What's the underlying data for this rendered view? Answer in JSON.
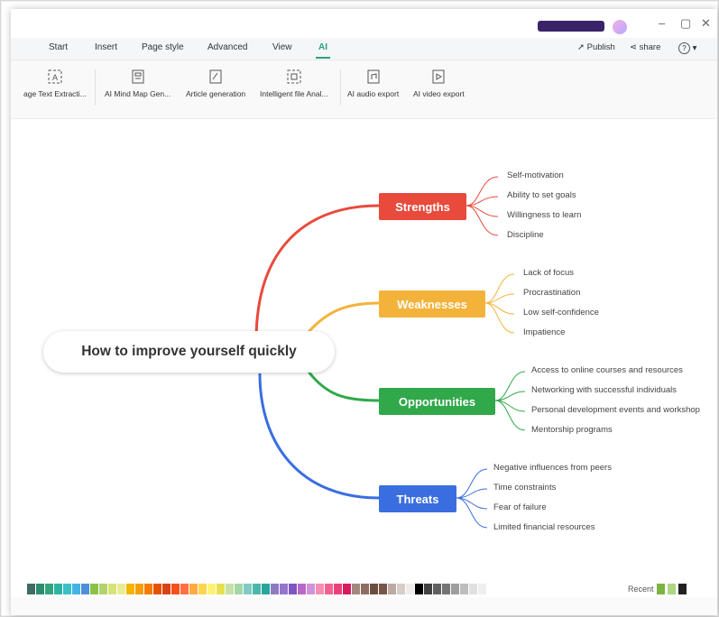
{
  "tabs": [
    {
      "label": "Start"
    },
    {
      "label": "Insert"
    },
    {
      "label": "Page style"
    },
    {
      "label": "Advanced"
    },
    {
      "label": "View"
    },
    {
      "label": "AI"
    }
  ],
  "active_tab": "AI",
  "header_actions": {
    "publish": "Publish",
    "share": "share",
    "help": "?"
  },
  "ribbon": [
    {
      "label": "age Text Extracti...",
      "icon": "text-extract-icon"
    },
    {
      "label": "AI Mind Map Gen...",
      "icon": "mindmap-gen-icon"
    },
    {
      "label": "Article generation",
      "icon": "article-icon"
    },
    {
      "label": "Intelligent file Anal...",
      "icon": "file-analysis-icon"
    },
    {
      "label": "AI audio export",
      "icon": "audio-export-icon"
    },
    {
      "label": "AI video export",
      "icon": "video-export-icon"
    }
  ],
  "mindmap": {
    "central": "How to improve yourself quickly",
    "branches": [
      {
        "title": "Strengths",
        "color": "#e84a3c",
        "items": [
          "Self-motivation",
          "Ability to set goals",
          "Willingness to learn",
          "Discipline"
        ]
      },
      {
        "title": "Weaknesses",
        "color": "#f3b33b",
        "items": [
          "Lack of focus",
          "Procrastination",
          "Low self-confidence",
          "Impatience"
        ]
      },
      {
        "title": "Opportunities",
        "color": "#31a84a",
        "items": [
          "Access to online courses and resources",
          "Networking with successful individuals",
          "Personal development events and workshop",
          "Mentorship programs"
        ]
      },
      {
        "title": "Threats",
        "color": "#3a6ee0",
        "items": [
          "Negative influences from peers",
          "Time constraints",
          "Fear of failure",
          "Limited financial resources"
        ]
      }
    ]
  },
  "palette": {
    "recent_label": "Recent",
    "colors": [
      "#3f6b64",
      "#2d8c6e",
      "#35a37e",
      "#2bb4a3",
      "#3ac1c6",
      "#46b3e6",
      "#4f8fd7",
      "#8bc34a",
      "#b3d36b",
      "#d6e37a",
      "#e8ec94",
      "#f4b400",
      "#f59e0b",
      "#f57c00",
      "#e65100",
      "#d84315",
      "#f4511e",
      "#ff7043",
      "#ffab40",
      "#ffd54f",
      "#fff176",
      "#e6e04d",
      "#c5e1a5",
      "#a5d6a7",
      "#80cbc4",
      "#4db6ac",
      "#26a69a",
      "#8e7cc3",
      "#9575cd",
      "#7e57c2",
      "#ba68c8",
      "#ce93d8",
      "#f48fb1",
      "#f06292",
      "#ec407a",
      "#d81b60",
      "#a1887f",
      "#8d6e63",
      "#6d4c41",
      "#795548",
      "#bcaaa4",
      "#d7ccc8",
      "#efebe9",
      "#000000",
      "#424242",
      "#616161",
      "#757575",
      "#9e9e9e",
      "#bdbdbd",
      "#e0e0e0",
      "#eeeeee"
    ],
    "recent_colors": [
      "#7cb342",
      "#aed581",
      "#212121"
    ]
  }
}
